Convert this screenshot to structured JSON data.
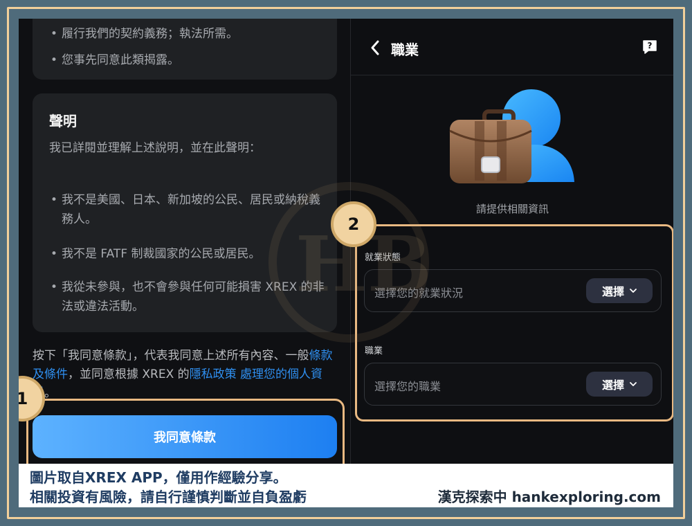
{
  "left": {
    "card1": {
      "bullets": [
        "履行我們的契約義務；執法所需。",
        "您事先同意此類揭露。"
      ]
    },
    "card2": {
      "title": "聲明",
      "desc": "我已詳閱並理解上述說明，並在此聲明：",
      "bullets": [
        "我不是美國、日本、新加坡的公民、居民或納稅義務人。",
        "我不是 FATF 制裁國家的公民或居民。",
        "我從未參與，也不會參與任何可能損害 XREX 的非法或違法活動。"
      ]
    },
    "terms": {
      "text1": "按下「我同意條款」，代表我同意上述所有內容、一般",
      "link1": "條款及條件",
      "text2": "，並同意根據 XREX 的",
      "link2": "隱私政策 處理您的個人資料",
      "text3": "。"
    },
    "agree_button": "我同意條款"
  },
  "badges": {
    "one": "1",
    "two": "2"
  },
  "right": {
    "title": "職業",
    "hint": "請提供相關資訊",
    "employment_label": "就業狀態",
    "employment_placeholder": "選擇您的就業狀況",
    "employment_select": "選擇",
    "occupation_label": "職業",
    "occupation_placeholder": "選擇您的職業",
    "occupation_select": "選擇"
  },
  "watermark": "HB",
  "footer": {
    "line1": "圖片取自XREX  APP，僅用作經驗分享。",
    "line2": "相關投資有風險，請自行謹慎判斷並自負盈虧",
    "brand": "漢克探索中 hankexploring.com"
  },
  "colors": {
    "accent": "#1d7ff1",
    "highlight": "#e9b982",
    "link": "#2f8ff0"
  }
}
